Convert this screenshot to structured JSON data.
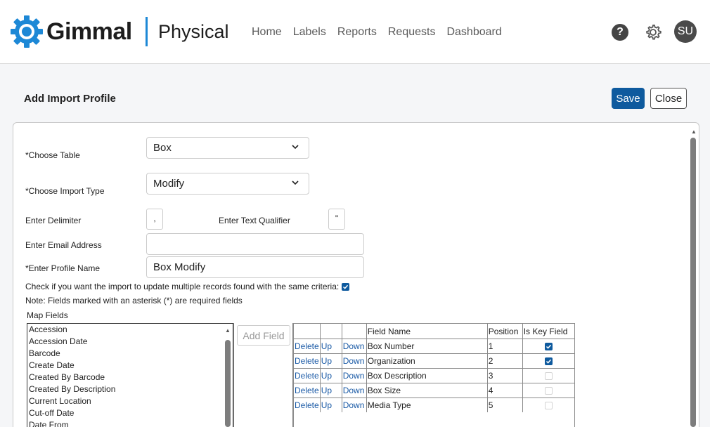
{
  "header": {
    "brand": "Gimmal",
    "product": "Physical",
    "nav": [
      "Home",
      "Labels",
      "Reports",
      "Requests",
      "Dashboard"
    ],
    "help_glyph": "?",
    "avatar_initials": "SU"
  },
  "page": {
    "title": "Add Import Profile",
    "save_label": "Save",
    "close_label": "Close"
  },
  "form": {
    "choose_table_label": "*Choose Table",
    "choose_table_value": "Box",
    "import_type_label": "*Choose Import Type",
    "import_type_value": "Modify",
    "delimiter_label": "Enter Delimiter",
    "delimiter_value": ",",
    "text_qualifier_label": "Enter Text Qualifier",
    "text_qualifier_value": "\"",
    "email_label": "Enter Email Address",
    "email_value": "",
    "profile_name_label": "*Enter Profile Name",
    "profile_name_value": "Box Modify",
    "multi_update_text": "Check if you want the import to update multiple records found with the same criteria:",
    "multi_update_checked": true,
    "note": "Note: Fields marked with an asterisk (*) are required fields",
    "map_fields_label": "Map Fields"
  },
  "available_fields": [
    "Accession",
    "Accession Date",
    "Barcode",
    "Create Date",
    "Created By Barcode",
    "Created By Description",
    "Current Location",
    "Cut-off Date",
    "Date From"
  ],
  "add_field_label": "Add Field",
  "mapping": {
    "headers": {
      "field_name": "Field Name",
      "position": "Position",
      "is_key": "Is Key Field"
    },
    "action_labels": {
      "delete": "Delete",
      "up": "Up",
      "down": "Down"
    },
    "rows": [
      {
        "field": "Box Number",
        "position": "1",
        "is_key": true
      },
      {
        "field": "Organization",
        "position": "2",
        "is_key": true
      },
      {
        "field": "Box Description",
        "position": "3",
        "is_key": false
      },
      {
        "field": "Box Size",
        "position": "4",
        "is_key": false
      },
      {
        "field": "Media Type",
        "position": "5",
        "is_key": false
      }
    ]
  },
  "colors": {
    "primary": "#0e5a9e",
    "accent": "#1d88d6",
    "link": "#1a5aa6"
  }
}
